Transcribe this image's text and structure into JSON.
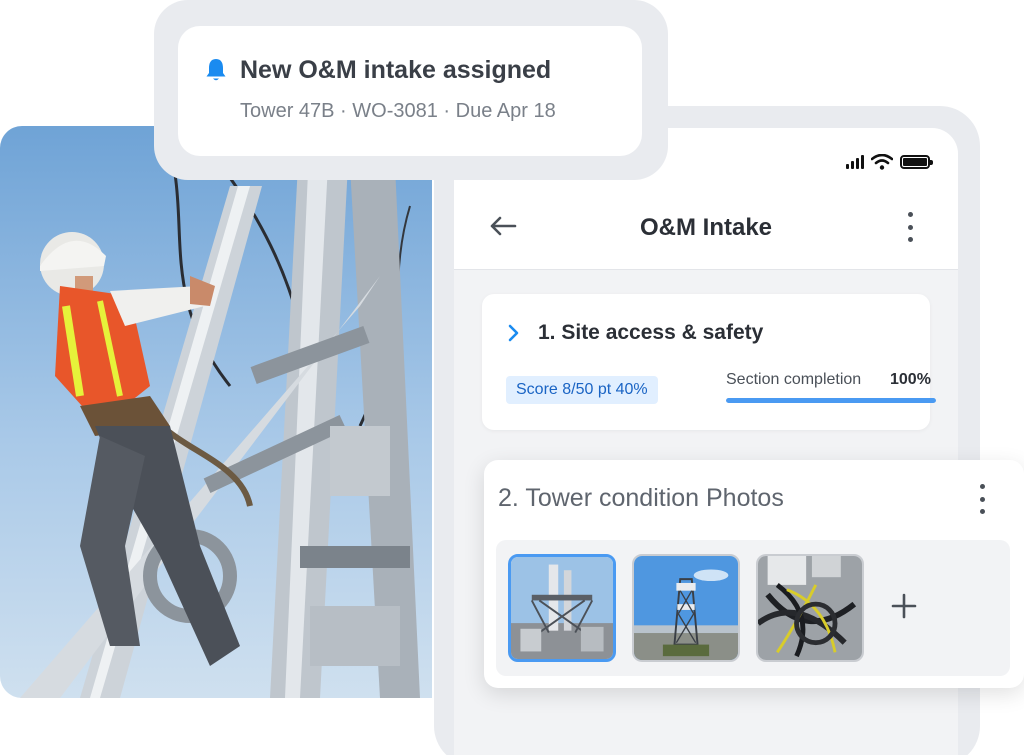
{
  "notification": {
    "title": "New O&M intake assigned",
    "subtitle": "Tower 47B · WO-3081 · Due Apr 18",
    "icon": "bell-icon",
    "accent": "#1a8bf0"
  },
  "app_bar": {
    "title": "O&M Intake",
    "back_icon": "arrow-left-icon",
    "menu_icon": "more-vertical-icon"
  },
  "status_bar": {
    "icons": [
      "signal-icon",
      "wifi-icon",
      "battery-icon"
    ]
  },
  "sections": [
    {
      "title": "1. Site access & safety",
      "expand_icon": "chevron-right-icon",
      "score": "Score 8/50 pt 40%",
      "completion_label": "Section completion",
      "completion_value": "100%",
      "completion_fraction": 1.0
    },
    {
      "title": "2. Tower condition Photos",
      "menu_icon": "more-vertical-icon",
      "photos": [
        {
          "name": "tower-platform-photo",
          "selected": true
        },
        {
          "name": "telecom-tower-photo",
          "selected": false
        },
        {
          "name": "cable-bundle-photo",
          "selected": false
        }
      ],
      "add_icon": "plus-icon"
    }
  ],
  "colors": {
    "accent_blue": "#4a9af2",
    "badge_bg": "#e1efff",
    "badge_text": "#1a64c4"
  }
}
